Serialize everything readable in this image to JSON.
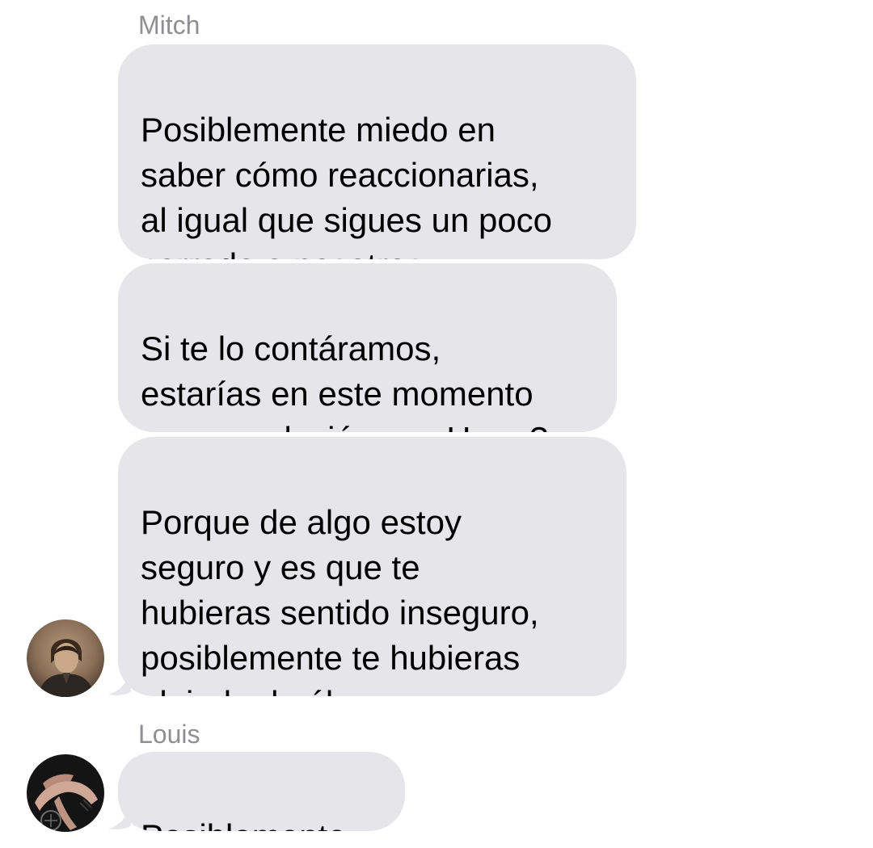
{
  "conversation": {
    "groups": [
      {
        "sender": "Mitch",
        "avatar_icon": "contact-avatar-photo",
        "messages": [
          {
            "text": "Posiblemente miedo en\nsaber cómo reaccionarias,\nal igual que sigues un poco\ncerrado a nosotros"
          },
          {
            "text": "Si te lo contáramos,\nestarías en este momento\nen una relación con Harry?"
          },
          {
            "text": "Porque de algo estoy\nseguro y es que te\nhubieras sentido inseguro,\nposiblemente te hubieras\nalejado de él"
          }
        ]
      },
      {
        "sender": "Louis",
        "avatar_icon": "contact-avatar-photo",
        "messages": [
          {
            "text": "Posiblemente."
          }
        ]
      }
    ]
  },
  "colors": {
    "bubble_background": "#e5e5ea",
    "sender_name": "#8e8e93",
    "message_text": "#000000",
    "page_background": "#ffffff"
  }
}
